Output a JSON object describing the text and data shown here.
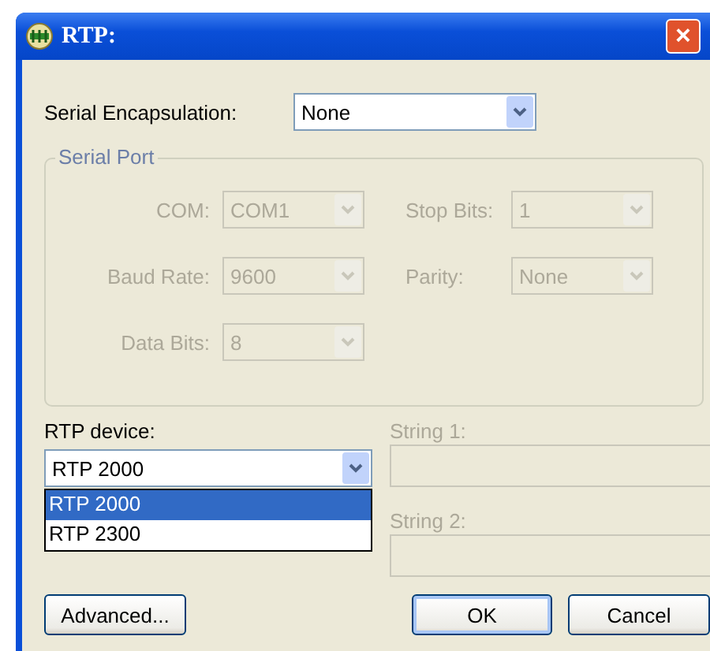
{
  "window": {
    "title": "RTP:",
    "close": "×"
  },
  "serial_encapsulation": {
    "label": "Serial Encapsulation:",
    "value": "None",
    "disabled": false
  },
  "serial_port": {
    "title": "Serial Port",
    "disabled": true,
    "fields": [
      {
        "label": "COM:",
        "value": "COM1"
      },
      {
        "label": "Stop Bits:",
        "value": "1"
      },
      {
        "label": "Baud Rate:",
        "value": "9600"
      },
      {
        "label": "Parity:",
        "value": "None"
      },
      {
        "label": "Data Bits:",
        "value": "8"
      }
    ]
  },
  "rtp_device": {
    "label": "RTP device:",
    "value": "RTP 2000",
    "expanded": true,
    "options": [
      {
        "label": "RTP 2000",
        "selected": true
      },
      {
        "label": "RTP 2300",
        "selected": false
      }
    ]
  },
  "strings": [
    {
      "label": "String 1:",
      "disabled": true
    },
    {
      "label": "String 2:",
      "disabled": true
    }
  ],
  "buttons": [
    {
      "label": "Advanced...",
      "kind": "left"
    },
    {
      "label": "OK",
      "kind": "default"
    },
    {
      "label": "Cancel",
      "kind": "normal"
    }
  ]
}
